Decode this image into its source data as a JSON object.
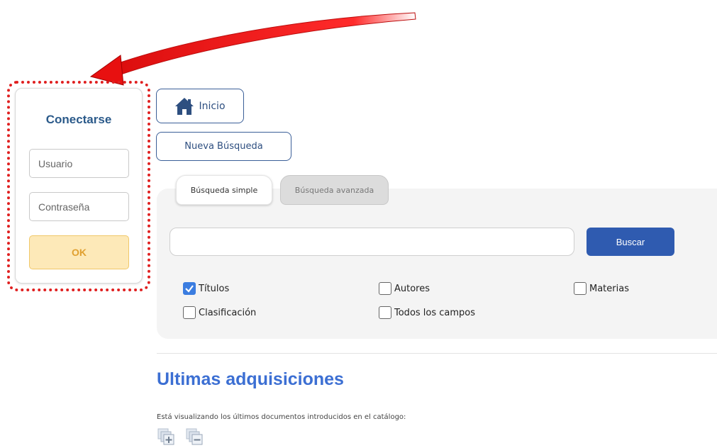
{
  "login": {
    "title": "Conectarse",
    "user_placeholder": "Usuario",
    "password_placeholder": "Contraseña",
    "ok_label": "OK"
  },
  "nav": {
    "home_label": "Inicio",
    "new_search_label": "Nueva Búsqueda"
  },
  "search": {
    "tabs": [
      {
        "label": "Búsqueda simple",
        "active": true
      },
      {
        "label": "Búsqueda avanzada",
        "active": false
      }
    ],
    "query_value": "",
    "button_label": "Buscar",
    "fields": [
      {
        "label": "Títulos",
        "checked": true
      },
      {
        "label": "Autores",
        "checked": false
      },
      {
        "label": "Materias",
        "checked": false
      },
      {
        "label": "Clasificación",
        "checked": false
      },
      {
        "label": "Todos los campos",
        "checked": false
      }
    ]
  },
  "acquisitions": {
    "title": "Ultimas adquisiciones",
    "description": "Está visualizando los últimos documentos introducidos en el catálogo:",
    "icons": [
      "expand-all-icon",
      "collapse-all-icon"
    ]
  },
  "colors": {
    "annotation_red": "#e02020",
    "primary_blue": "#2f5bb0",
    "title_blue": "#3c6fd3",
    "ok_yellow": "#fde9b8"
  }
}
